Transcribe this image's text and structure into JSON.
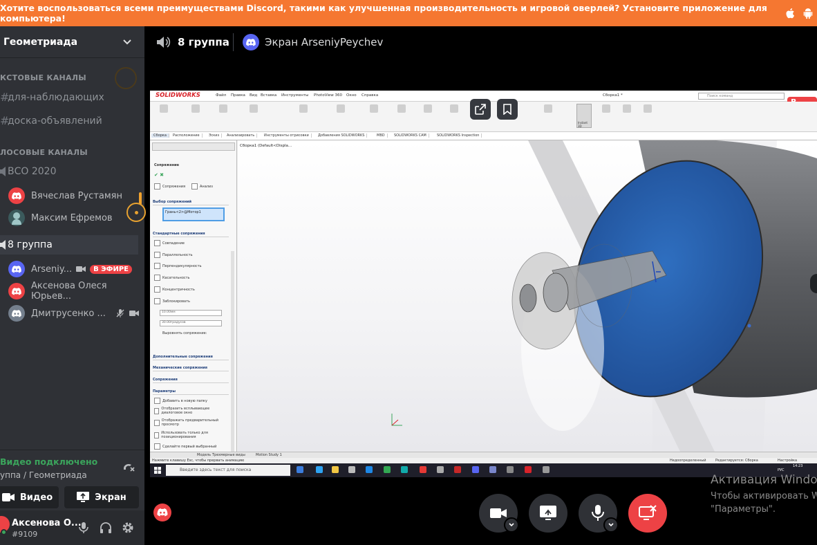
{
  "banner": {
    "text": "Хотите воспользоваться всеми преимуществами Discord, такими как улучшенная производительность и игровой оверлей? Установите приложение для компьютера!",
    "icons": [
      "apple-icon",
      "android-icon"
    ]
  },
  "sidebar": {
    "server_name": "Геометриада",
    "text_category": "КСТОВЫЕ КАНАЛЫ",
    "text_channels": [
      "для-наблюдающих",
      "доска-объявлений"
    ],
    "voice_category": "ЛОСОВЫЕ КАНАЛЫ",
    "voice_channels": [
      {
        "name": "ВСО 2020",
        "users": [
          {
            "name": "Вячеслав Рустамян",
            "avatar": "red"
          },
          {
            "name": "Максим Ефремов",
            "avatar": "photo"
          }
        ]
      },
      {
        "name": "8 группа",
        "users": [
          {
            "name": "Arseniy...",
            "avatar": "blurple",
            "badge": "В ЭФИРЕ"
          },
          {
            "name": "Аксенова Олеся Юрьев...",
            "avatar": "red"
          },
          {
            "name": "Дмитрусенко ...",
            "avatar": "grey"
          }
        ]
      }
    ]
  },
  "rtc": {
    "status": "Видео подключено",
    "location": "уппа / Геометриада",
    "video_label": "Видео",
    "screen_label": "Экран"
  },
  "user": {
    "name": "Аксенова О...",
    "tag": "#9109"
  },
  "header": {
    "channel": "8 группа",
    "stream_title": "Экран ArseniyPeychev"
  },
  "stream": {
    "live_badge": "В ЭФИ",
    "sw": {
      "logo": "SOLIDWORKS",
      "menu": [
        "Файл",
        "Правка",
        "Вид",
        "Вставка",
        "Инструменты",
        "PhotoView 360",
        "Окно",
        "Справка"
      ],
      "doc_title": "Сборка1 *",
      "search_placeholder": "Поиск команд",
      "tabs": [
        "Сборка",
        "Расположение",
        "Эскиз",
        "Анализировать",
        "Инструменты отрисовки",
        "Добавления SOLIDWORKS",
        "MBD",
        "SOLIDWORKS CAM",
        "SOLIDWORKS Inspection"
      ],
      "instant3d": "Instant 3D",
      "tree_root": "Сборка1 (Default<Displa...",
      "pm_title": "Сопряжение",
      "pm_tab_mates": "Сопряжения",
      "pm_tab_analysis": "Анализ",
      "pm_sel_header": "Выбор сопряжений",
      "pm_sel_value": "Грань<2>@Мотор1",
      "pm_std_header": "Стандартные сопряжения",
      "pm_std": [
        "Совпадение",
        "Параллельность",
        "Перпендикулярность",
        "Касательность",
        "Концентричность",
        "Заблокировать"
      ],
      "pm_dist": "10.00мм",
      "pm_angle": "30.00градусов",
      "pm_align": "Выровнять сопряжение:",
      "pm_sections": [
        "Дополнительные сопряжения",
        "Механические сопряжения",
        "Сопряжения",
        "Параметры"
      ],
      "pm_options": [
        "Добавить в новую папку",
        "Отобразить всплывающее диалоговое окно",
        "Отображать предварительный просмотр",
        "Использовать только для позиционирования",
        "Сделайте первый выбранный"
      ],
      "bottom_tabs": [
        "Модель",
        "Трехмерные виды",
        "Motion Study 1"
      ],
      "status_left": "Нажмите клавишу Esc, чтобы прервать анимацию",
      "status_items": [
        "Недоопределенный",
        "Редактируется: Сборка",
        "Настройка"
      ],
      "win_search": "Введите здесь текст для поиска",
      "clock": "14:23",
      "lang": "РУС"
    }
  },
  "activation": {
    "title": "Активация Windo",
    "line1": "Чтобы активировать W",
    "line2": "\"Параметры\"."
  },
  "colors": {
    "sidebar_bg": "#2f3136",
    "banner": "#f57731",
    "live": "#ed4245",
    "connected": "#3ba55c",
    "blurple": "#5865f2"
  }
}
